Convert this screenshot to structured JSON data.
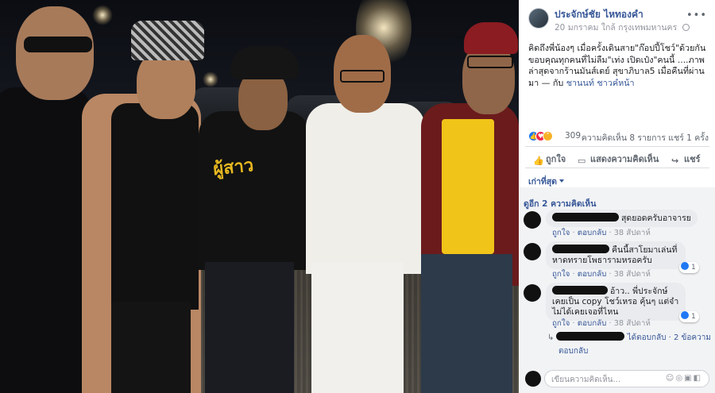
{
  "post": {
    "author": "ประจักษ์ชัย ไหทองคำ",
    "date": "20 มกราคม",
    "location": "ใกล้ กรุงเทพมหานคร",
    "more_icon": "more-horizontal-icon",
    "caption": "คิดถึงพี่น้องๆ เมื่อครั้งเดินสาย\"ก๊อปปี้โชว์\"ด้วยกัน ขอบคุณทุกคนที่ไม่ลืม\"เท่ง เปิดเป๋ง\"คนนี้ ....ภาพล่าสุดจากร้านมันส์เดย์ สุขาภิบาล5 เมื่อคืนที่ผ่านมา",
    "tagged_prefix": "— กับ",
    "tagged": "ชานนท์ ชาวคํหน้า"
  },
  "stats": {
    "reactions": "309",
    "comments_shares": "ความคิดเห็น 8 รายการ  แชร์ 1 ครั้ง"
  },
  "actions": {
    "like": "ถูกใจ",
    "comment": "แสดงความคิดเห็น",
    "share": "แชร์"
  },
  "comments_ui": {
    "sort_label": "เก่าที่สุด",
    "view_more": "ดูอีก 2 ความคิดเห็น",
    "like_label": "ถูกใจ",
    "reply_label": "ตอบกลับ",
    "input_placeholder": "เขียนความคิดเห็น..."
  },
  "comments": [
    {
      "text": "สุดยอดครับอาจารย",
      "time": "38 สัปดาห์"
    },
    {
      "text": "คืนนี้สาโยมาเล่นที่ หาดทรายโพธารามหรอครับ",
      "time": "38 สัปดาห์",
      "likes": "1"
    },
    {
      "text": "อ้าว.. พี่ประจักษ์ เคยเป็น copy โชว์เหรอ คุ้นๆ แต่จำไม่ได้เคยเจอที่ไหน",
      "time": "38 สัปดาห์",
      "likes": "1"
    }
  ],
  "reply_row": {
    "text": "ได้ตอบกลับ · 2 ข้อความ",
    "reply": "ตอบกลับ"
  },
  "colors": {
    "link": "#385898",
    "like_blue": "#2078f4",
    "love_red": "#f0284a",
    "panel_bg": "#ffffff",
    "comment_bg": "#f2f3f5"
  }
}
